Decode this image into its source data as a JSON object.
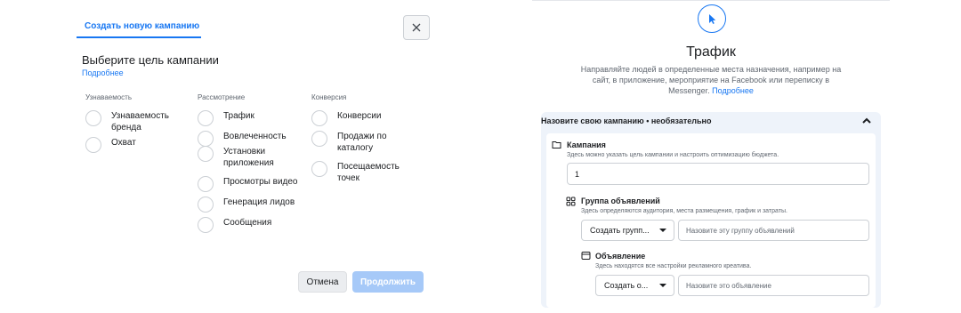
{
  "left": {
    "tab_label": "Создать новую кампанию",
    "heading": "Выберите цель кампании",
    "more_link": "Подробнее",
    "columns": [
      {
        "title": "Узнаваемость",
        "options": [
          "Узнаваемость бренда",
          "Охват"
        ]
      },
      {
        "title": "Рассмотрение",
        "options": [
          "Трафик",
          "Вовлеченность",
          "Установки приложения",
          "Просмотры видео",
          "Генерация лидов",
          "Сообщения"
        ]
      },
      {
        "title": "Конверсия",
        "options": [
          "Конверсии",
          "Продажи по каталогу",
          "Посещаемость точек"
        ]
      }
    ],
    "cancel_label": "Отмена",
    "continue_label": "Продолжить"
  },
  "right": {
    "title": "Трафик",
    "description": "Направляйте людей в определенные места назначения, например на сайт, в приложение, мероприятие на Facebook или переписку в Messenger.",
    "description_link": "Подробнее",
    "section_title": "Назовите свою кампанию • необязательно",
    "campaign": {
      "label": "Кампания",
      "hint": "Здесь можно указать цель кампании и настроить оптимизацию бюджета.",
      "value": "1"
    },
    "adset": {
      "label": "Группа объявлений",
      "hint": "Здесь определяются аудитория, места размещения, график и затраты.",
      "select_value": "Создать групп...",
      "name_placeholder": "Назовите эту группу объявлений"
    },
    "ad": {
      "label": "Объявление",
      "hint": "Здесь находятся все настройки рекламного креатива.",
      "select_value": "Создать о...",
      "name_placeholder": "Назовите это объявление"
    }
  },
  "colors": {
    "accent": "#1877f2",
    "disabled_accent": "#a6c9f8",
    "section_bg": "#eef3fa"
  },
  "icons": [
    "close-icon",
    "cursor-icon",
    "chevron-up-icon",
    "folder-icon",
    "grid-icon",
    "ad-icon"
  ]
}
